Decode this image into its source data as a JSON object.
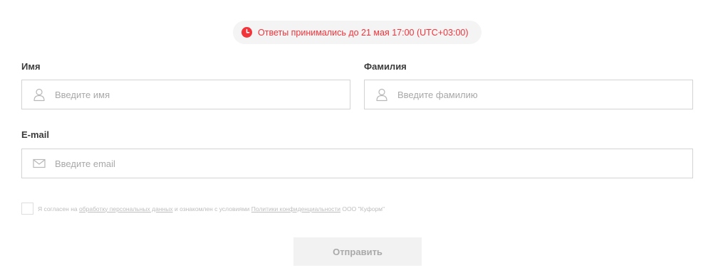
{
  "notice": {
    "icon": "clock-icon",
    "text": "Ответы принимались до 21 мая 17:00 (UTC+03:00)",
    "color": "#f2333a"
  },
  "form": {
    "first_name": {
      "label": "Имя",
      "placeholder": "Введите имя",
      "icon": "user-icon"
    },
    "last_name": {
      "label": "Фамилия",
      "placeholder": "Введите фамилию",
      "icon": "user-icon"
    },
    "email": {
      "label": "E-mail",
      "placeholder": "Введите email",
      "icon": "envelope-icon"
    },
    "consent": {
      "checked": false,
      "text_before": "Я согласен на",
      "link1": "обработку персональных данных",
      "text_middle": "и ознакомлен с условиями",
      "link2": "Политики конфиденциальности",
      "text_after": "ООО \"Куформ\""
    },
    "submit_label": "Отправить"
  }
}
